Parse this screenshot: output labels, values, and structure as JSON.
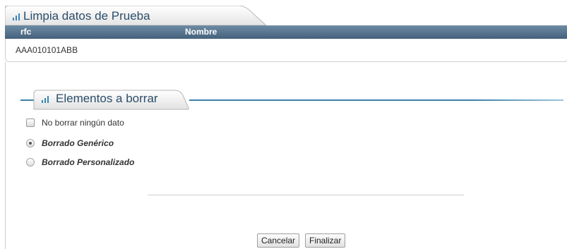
{
  "panel": {
    "title": "Limpia datos de Prueba",
    "columns": [
      "rfc",
      "Nombre"
    ],
    "rows": [
      {
        "rfc": "AAA010101ABB",
        "nombre": ""
      }
    ]
  },
  "section": {
    "title": "Elementos a borrar",
    "options": [
      {
        "type": "checkbox",
        "label": "No borrar ningún dato",
        "checked": false
      },
      {
        "type": "radio",
        "label": "Borrado Genérico",
        "checked": true
      },
      {
        "type": "radio",
        "label": "Borrado Personalizado",
        "checked": false
      }
    ]
  },
  "buttons": {
    "cancel": "Cancelar",
    "finish": "Finalizar"
  },
  "colors": {
    "accent": "#3a7fa8",
    "header_bar": "#5a7690",
    "title_text": "#2c4d6b"
  }
}
